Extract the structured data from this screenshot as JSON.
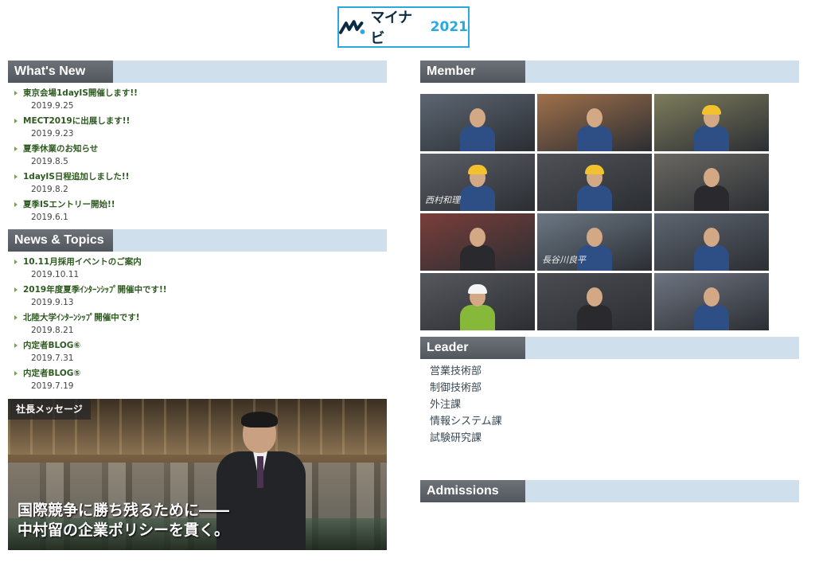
{
  "logo": {
    "text": "マイナビ",
    "year": "2021",
    "brand_color": "#29a9e0"
  },
  "whats_new": {
    "heading": "What's New",
    "items": [
      {
        "title": "東京会場1dayIS開催します!!",
        "date": "2019.9.25"
      },
      {
        "title": "MECT2019に出展します!!",
        "date": "2019.9.23"
      },
      {
        "title": "夏季休業のお知らせ",
        "date": "2019.8.5"
      },
      {
        "title": "1dayIS日程追加しました!!",
        "date": "2019.8.2"
      },
      {
        "title": "夏季ISエントリー開始!!",
        "date": "2019.6.1"
      }
    ]
  },
  "news_topics": {
    "heading": "News & Topics",
    "items": [
      {
        "title": "10.11月採用イベントのご案内",
        "date": "2019.10.11"
      },
      {
        "title": "2019年度夏季ｲﾝﾀｰﾝｼｯﾌﾟ開催中です!!",
        "date": "2019.9.13"
      },
      {
        "title": "北陸大学ｲﾝﾀｰﾝｼｯﾌﾟ開催中です!",
        "date": "2019.8.21"
      },
      {
        "title": "内定者BLOG⑥",
        "date": "2019.7.31"
      },
      {
        "title": "内定者BLOG⑤",
        "date": "2019.7.19"
      }
    ]
  },
  "president": {
    "label": "社長メッセージ",
    "message_line1": "国際競争に勝ち残るために――",
    "message_line2": "中村留の企業ポリシーを貫く。"
  },
  "member": {
    "heading": "Member",
    "tiles": [
      {
        "name": "member-1",
        "bg": "#5c6672",
        "fig": "work",
        "scrawl": ""
      },
      {
        "name": "member-2",
        "bg": "#a0704a",
        "fig": "work",
        "scrawl": ""
      },
      {
        "name": "member-3",
        "bg": "#7d7c5c",
        "fig": "helmet",
        "scrawl": ""
      },
      {
        "name": "member-4",
        "bg": "#5b5f66",
        "fig": "helmet",
        "scrawl": "西村和理"
      },
      {
        "name": "member-5",
        "bg": "#4e5156",
        "fig": "helmet",
        "scrawl": ""
      },
      {
        "name": "member-6",
        "bg": "#6a6862",
        "fig": "suit",
        "scrawl": ""
      },
      {
        "name": "member-7",
        "bg": "#7a3e3a",
        "fig": "suit",
        "scrawl": ""
      },
      {
        "name": "member-8",
        "bg": "#6c7884",
        "fig": "work",
        "scrawl": "長谷川良平"
      },
      {
        "name": "member-9",
        "bg": "#5e6570",
        "fig": "work",
        "scrawl": ""
      },
      {
        "name": "member-10",
        "bg": "#55585c",
        "fig": "helmet2",
        "scrawl": ""
      },
      {
        "name": "member-11",
        "bg": "#4a4c52",
        "fig": "suit",
        "scrawl": ""
      },
      {
        "name": "member-12",
        "bg": "#6e7480",
        "fig": "work",
        "scrawl": ""
      }
    ]
  },
  "leader": {
    "heading": "Leader",
    "items": [
      "営業技術部",
      "制御技術部",
      "外注課",
      "情報システム課",
      "試験研究課"
    ]
  },
  "admissions": {
    "heading": "Admissions"
  }
}
